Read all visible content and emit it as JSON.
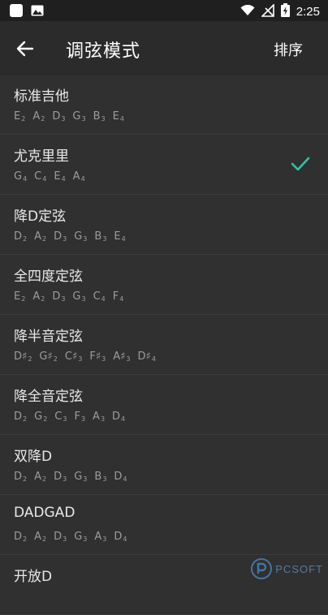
{
  "status_bar": {
    "time": "2:25"
  },
  "app_bar": {
    "title": "调弦模式",
    "sort_label": "排序"
  },
  "accent_color": "#2ec4a9",
  "tunings": [
    {
      "name": "标准吉他",
      "notes": [
        [
          "E",
          "2"
        ],
        [
          "A",
          "2"
        ],
        [
          "D",
          "3"
        ],
        [
          "G",
          "3"
        ],
        [
          "B",
          "3"
        ],
        [
          "E",
          "4"
        ]
      ],
      "selected": false
    },
    {
      "name": "尤克里里",
      "notes": [
        [
          "G",
          "4"
        ],
        [
          "C",
          "4"
        ],
        [
          "E",
          "4"
        ],
        [
          "A",
          "4"
        ]
      ],
      "selected": true
    },
    {
      "name": "降D定弦",
      "notes": [
        [
          "D",
          "2"
        ],
        [
          "A",
          "2"
        ],
        [
          "D",
          "3"
        ],
        [
          "G",
          "3"
        ],
        [
          "B",
          "3"
        ],
        [
          "E",
          "4"
        ]
      ],
      "selected": false
    },
    {
      "name": "全四度定弦",
      "notes": [
        [
          "E",
          "2"
        ],
        [
          "A",
          "2"
        ],
        [
          "D",
          "3"
        ],
        [
          "G",
          "3"
        ],
        [
          "C",
          "4"
        ],
        [
          "F",
          "4"
        ]
      ],
      "selected": false
    },
    {
      "name": "降半音定弦",
      "notes": [
        [
          "D♯",
          "2"
        ],
        [
          "G♯",
          "2"
        ],
        [
          "C♯",
          "3"
        ],
        [
          "F♯",
          "3"
        ],
        [
          "A♯",
          "3"
        ],
        [
          "D♯",
          "4"
        ]
      ],
      "selected": false
    },
    {
      "name": "降全音定弦",
      "notes": [
        [
          "D",
          "2"
        ],
        [
          "G",
          "2"
        ],
        [
          "C",
          "3"
        ],
        [
          "F",
          "3"
        ],
        [
          "A",
          "3"
        ],
        [
          "D",
          "4"
        ]
      ],
      "selected": false
    },
    {
      "name": "双降D",
      "notes": [
        [
          "D",
          "2"
        ],
        [
          "A",
          "2"
        ],
        [
          "D",
          "3"
        ],
        [
          "G",
          "3"
        ],
        [
          "B",
          "3"
        ],
        [
          "D",
          "4"
        ]
      ],
      "selected": false
    },
    {
      "name": "DADGAD",
      "notes": [
        [
          "D",
          "2"
        ],
        [
          "A",
          "2"
        ],
        [
          "D",
          "3"
        ],
        [
          "G",
          "3"
        ],
        [
          "A",
          "3"
        ],
        [
          "D",
          "4"
        ]
      ],
      "selected": false
    },
    {
      "name": "开放D",
      "notes": [],
      "selected": false
    }
  ],
  "watermark": {
    "text": "PCSOFT"
  }
}
